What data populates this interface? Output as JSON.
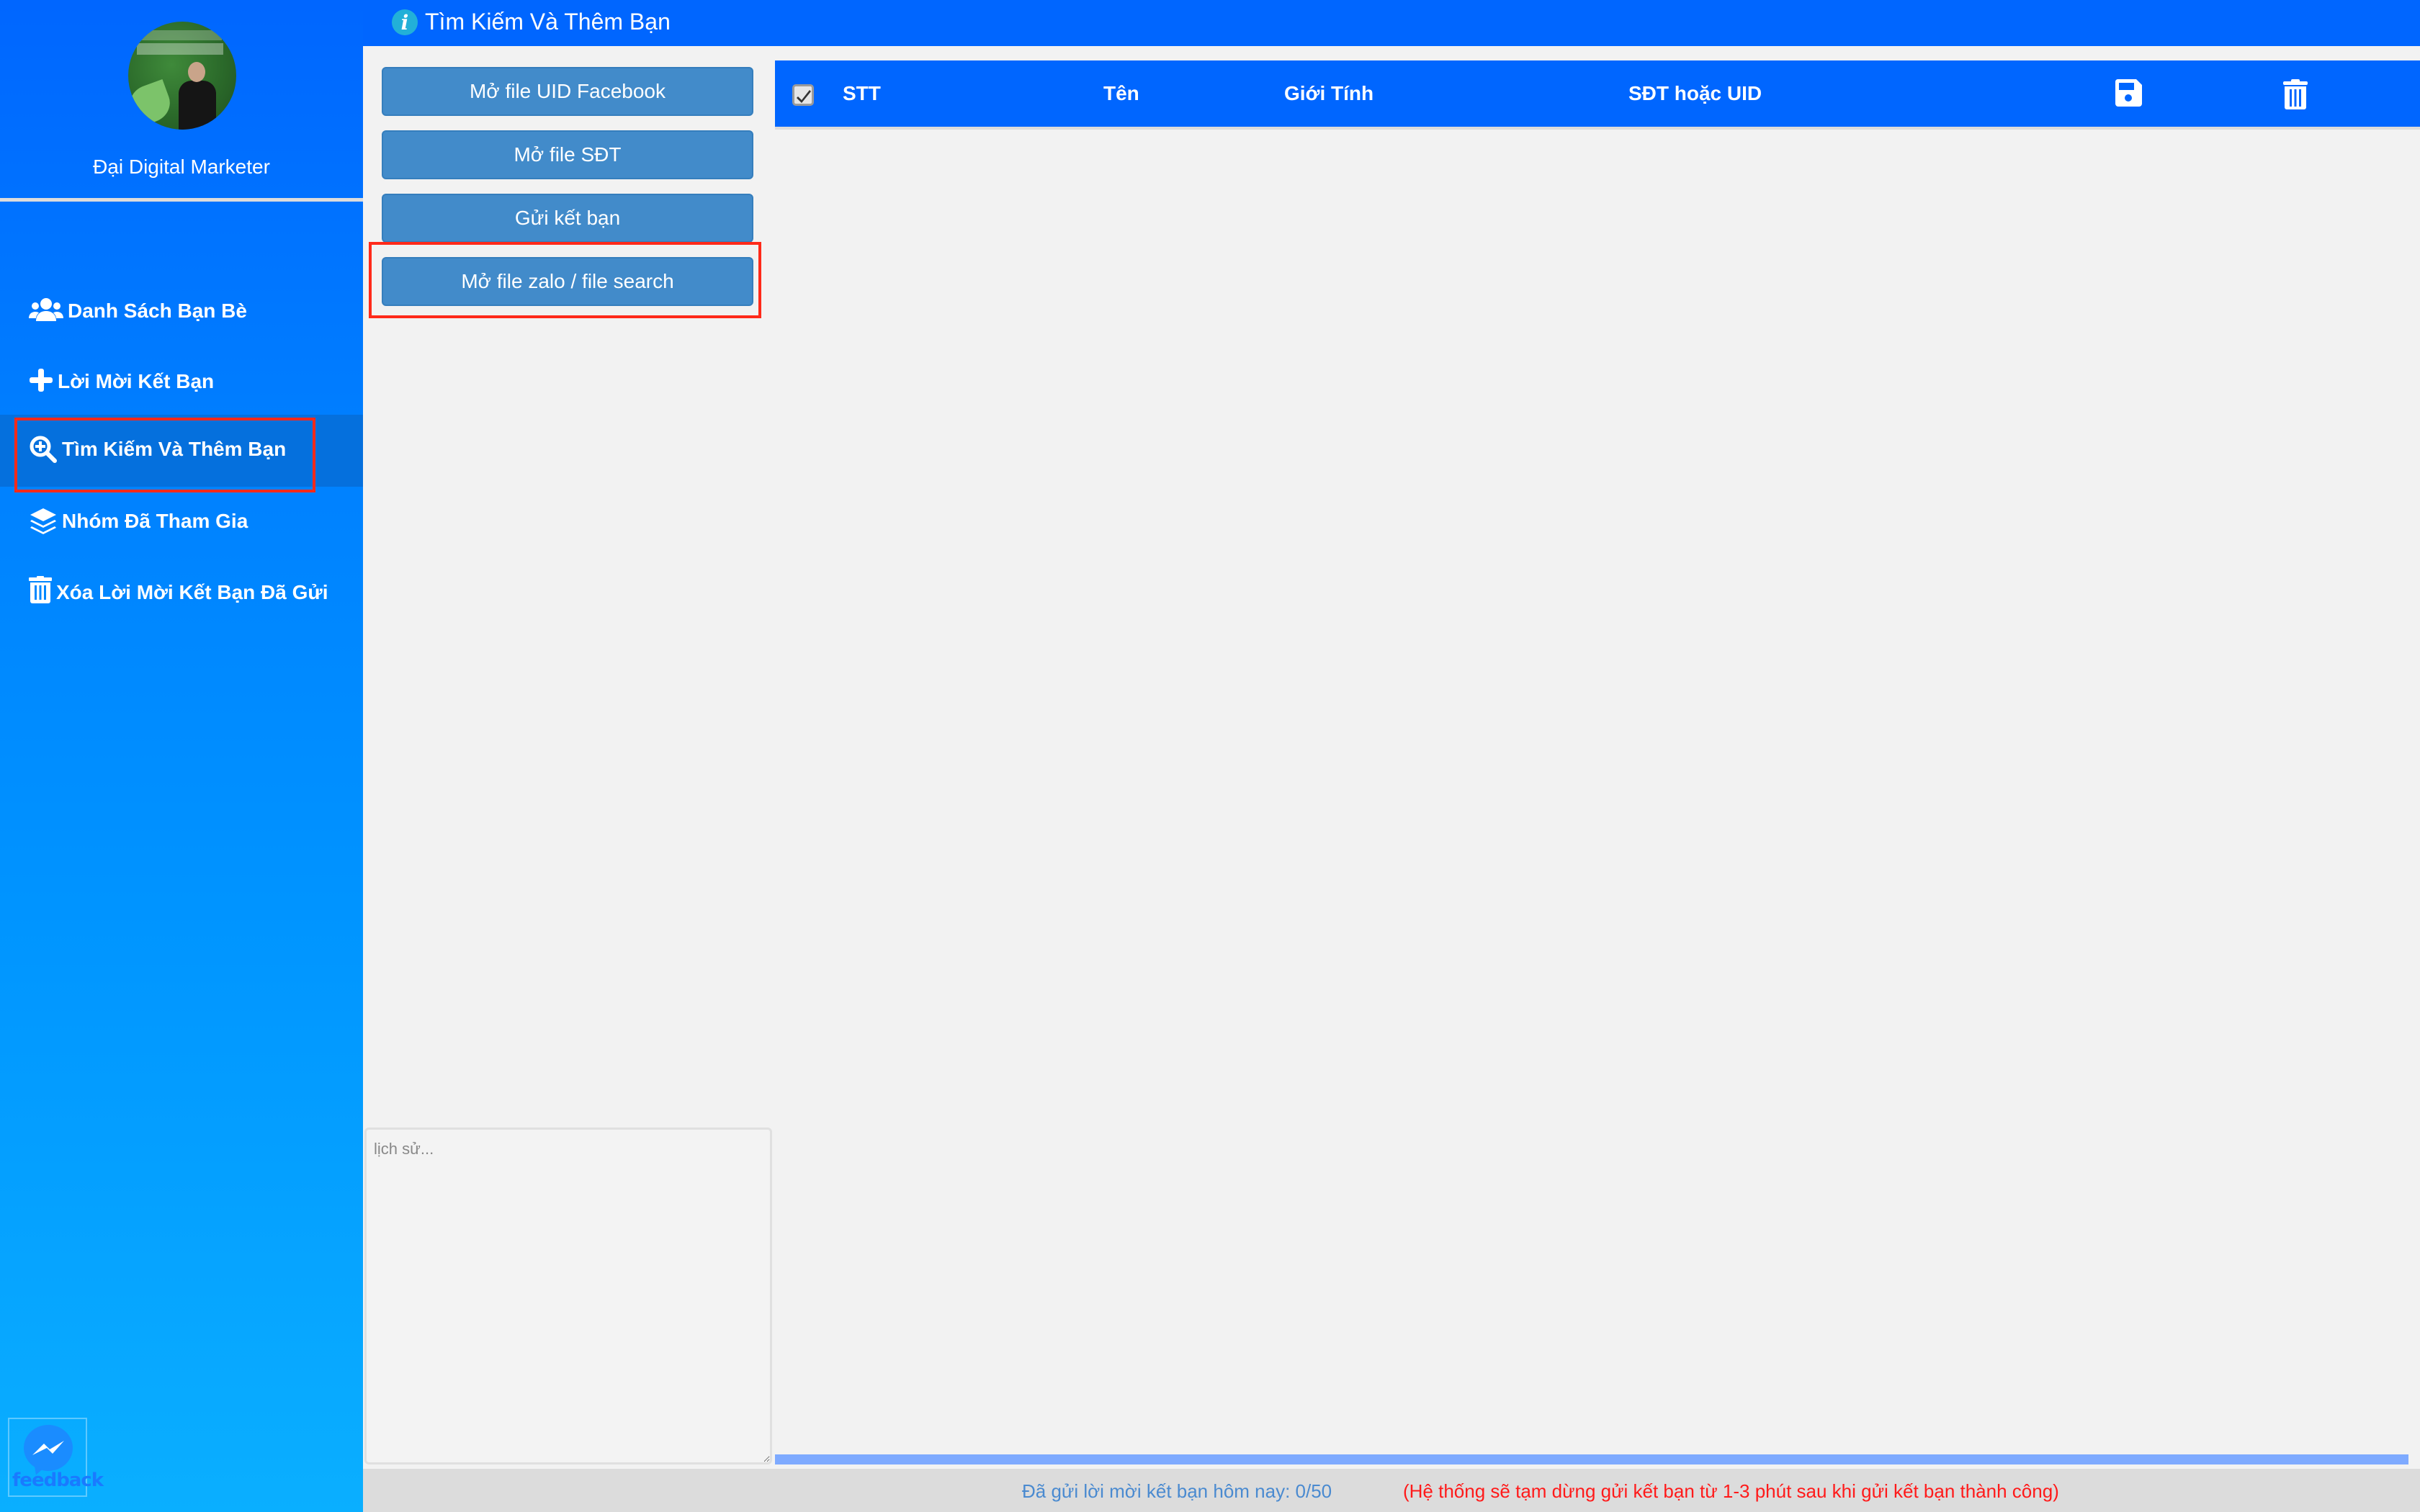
{
  "sidebar": {
    "profile_name": "Đại Digital Marketer",
    "avatar_alt": "profile-photo",
    "items": [
      {
        "label": "Danh Sách Bạn Bè",
        "icon": "users-icon",
        "active": false
      },
      {
        "label": "Lời Mời Kết Bạn",
        "icon": "plus-icon",
        "active": false
      },
      {
        "label": "Tìm Kiếm Và Thêm Bạn",
        "icon": "search-plus-icon",
        "active": true
      },
      {
        "label": "Nhóm Đã Tham Gia",
        "icon": "layers-icon",
        "active": false
      },
      {
        "label": "Xóa Lời Mời Kết Bạn Đã Gửi",
        "icon": "trash-icon",
        "active": false
      }
    ],
    "feedback_label": "feedback"
  },
  "header": {
    "icon": "info-icon",
    "info_glyph": "i",
    "title": "Tìm Kiếm Và Thêm Bạn"
  },
  "actions": {
    "buttons": [
      {
        "label": "Mở file UID Facebook"
      },
      {
        "label": "Mở file SĐT"
      },
      {
        "label": "Gửi kết bạn"
      },
      {
        "label": "Mở file zalo / file search"
      }
    ],
    "history_placeholder": "lịch sử...",
    "history_value": ""
  },
  "table": {
    "select_all_checked": true,
    "columns": [
      "STT",
      "Tên",
      "Giới Tính",
      "SĐT hoặc UID"
    ],
    "actions": [
      {
        "icon": "save-icon"
      },
      {
        "icon": "trash-icon"
      }
    ],
    "rows": []
  },
  "progress": {
    "percent": 0
  },
  "status": {
    "sent_today": "Đã gửi lời mời kết bạn hôm nay: 0/50",
    "note": "(Hệ thống sẽ tạm dừng gửi kết bạn từ 1-3 phút sau khi gửi kết bạn thành công)"
  },
  "colors": {
    "primary": "#0066ff",
    "button": "#428bca",
    "active_nav": "#0570dd",
    "progress_track": "#7eaaff",
    "status_count": "#4a8ad0",
    "status_note": "#ff1a1a",
    "highlight_annotation": "#ff2a1a"
  }
}
